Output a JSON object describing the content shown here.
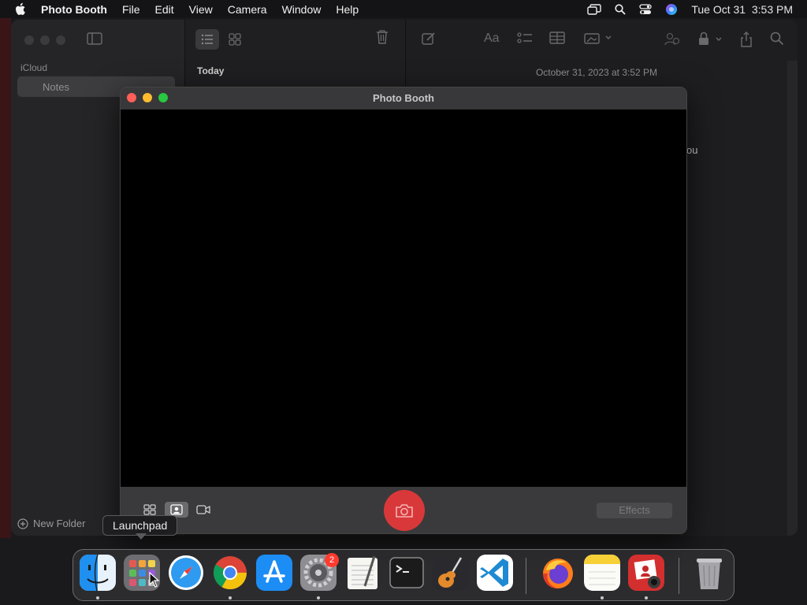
{
  "menubar": {
    "app_name": "Photo Booth",
    "menus": [
      "File",
      "Edit",
      "View",
      "Camera",
      "Window",
      "Help"
    ],
    "datetime": "Tue Oct 31  3:53 PM"
  },
  "notes": {
    "sidebar_section": "iCloud",
    "folder_name": "Notes",
    "new_folder_label": "New Folder",
    "list_section": "Today",
    "editor_date": "October 31, 2023 at 3:52 PM",
    "editor_snippet": "ou"
  },
  "photobooth": {
    "title": "Photo Booth",
    "effects_label": "Effects"
  },
  "tooltip": {
    "text": "Launchpad"
  },
  "dock": {
    "items": [
      "Finder",
      "Launchpad",
      "Safari",
      "Chrome",
      "App Store",
      "System Settings",
      "TextEdit",
      "Terminal",
      "GarageBand",
      "Visual Studio Code",
      "Firefox",
      "Notes",
      "Photo Booth",
      "Trash"
    ],
    "settings_badge": "2"
  },
  "colors": {
    "close": "#ff5f57",
    "minimize": "#febc2e",
    "maximize": "#28c840",
    "shutter": "#d9383a"
  }
}
